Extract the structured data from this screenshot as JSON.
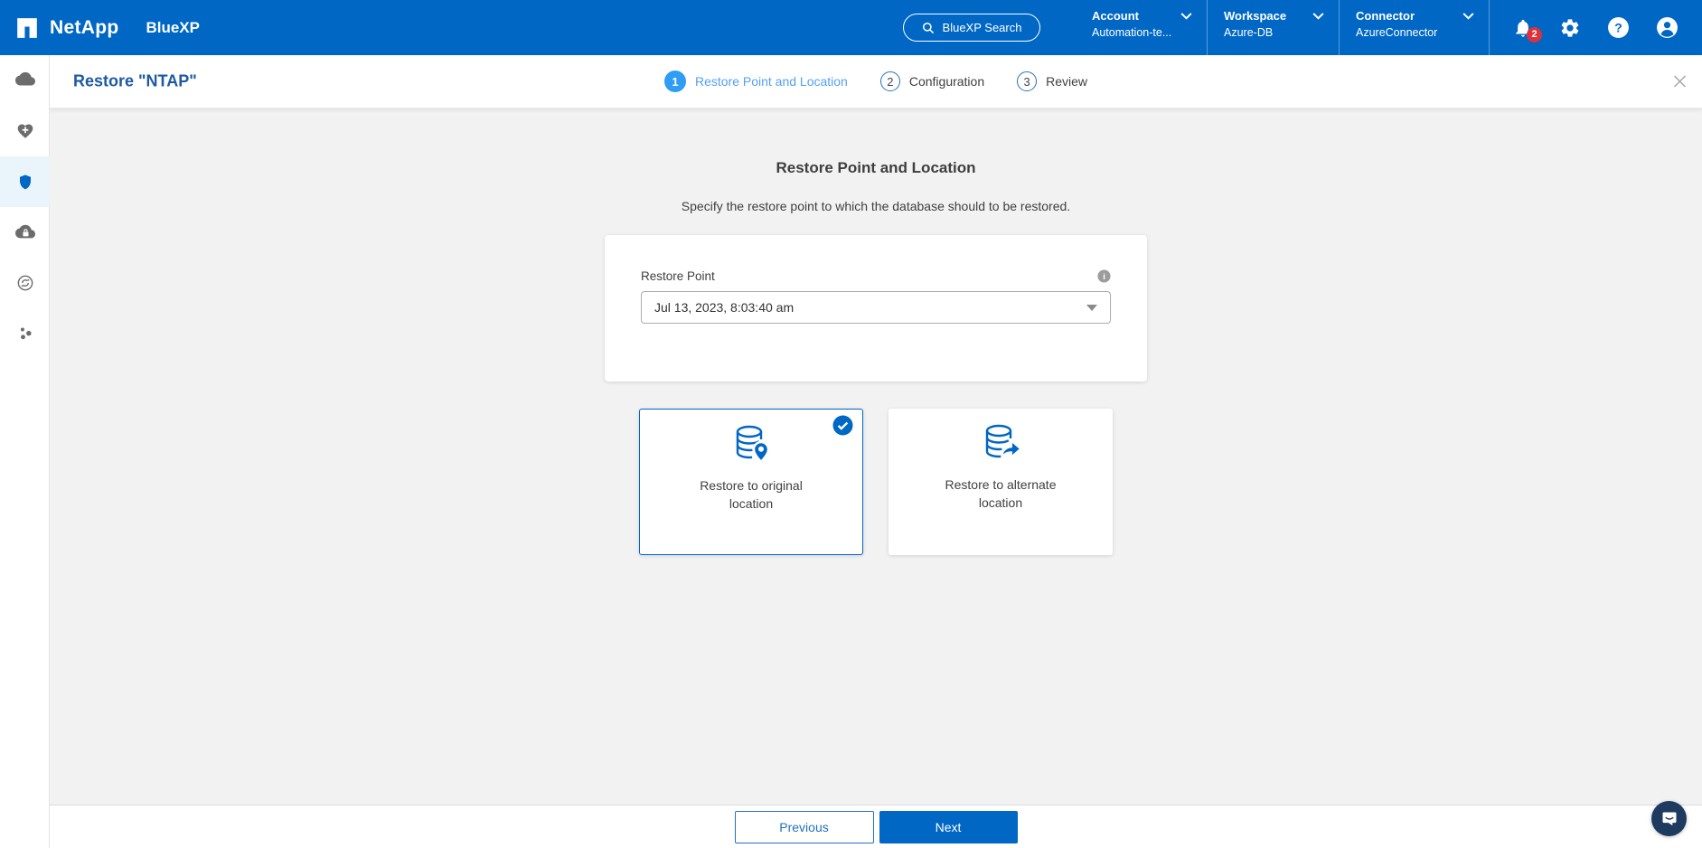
{
  "topbar": {
    "brand": {
      "company": "NetApp",
      "product": "BlueXP",
      "logo_icon": "netapp-logo"
    },
    "search": {
      "label": "BlueXP Search",
      "icon": "search-icon"
    },
    "account": {
      "label": "Account",
      "value": "Automation-te..."
    },
    "workspace": {
      "label": "Workspace",
      "value": "Azure-DB"
    },
    "connector": {
      "label": "Connector",
      "value": "AzureConnector"
    },
    "notifications": {
      "count": "2",
      "icon": "bell-icon"
    },
    "action_icons": [
      "bell-icon",
      "gear-icon",
      "help-icon",
      "account-icon"
    ]
  },
  "sidebar": {
    "items": [
      {
        "icon": "cloud-icon",
        "active": false
      },
      {
        "icon": "heart-plus-icon",
        "active": false
      },
      {
        "icon": "shield-icon",
        "active": true
      },
      {
        "icon": "cloud-lock-icon",
        "active": false
      },
      {
        "icon": "sync-circle-icon",
        "active": false
      },
      {
        "icon": "nodes-icon",
        "active": false
      }
    ]
  },
  "wizard": {
    "title": "Restore \"NTAP\"",
    "steps": [
      {
        "number": "1",
        "label": "Restore Point and Location",
        "state": "active"
      },
      {
        "number": "2",
        "label": "Configuration",
        "state": "upcoming"
      },
      {
        "number": "3",
        "label": "Review",
        "state": "upcoming"
      }
    ],
    "close_icon": "close-icon"
  },
  "main": {
    "heading": "Restore Point and Location",
    "subheading": "Specify the restore point to which the database should to be restored.",
    "restore_point": {
      "label": "Restore Point",
      "value": "Jul 13, 2023, 8:03:40 am",
      "info_icon": "info-icon",
      "caret_icon": "caret-down-icon"
    },
    "location_options": [
      {
        "label": "Restore to original location",
        "icon": "database-location-icon",
        "selected": true,
        "badge_icon": "check-badge-icon"
      },
      {
        "label": "Restore to alternate location",
        "icon": "database-share-icon",
        "selected": false
      }
    ]
  },
  "footer": {
    "previous_label": "Previous",
    "next_label": "Next",
    "chat_icon": "chat-bubble-icon"
  },
  "colors": {
    "header_bg": "#0067C5",
    "primary_blue": "#0067C5",
    "active_step_blue": "#2F9DF3",
    "title_blue": "#1E5AA2",
    "notification_red": "#DE3139",
    "content_bg": "#F2F2F2",
    "sidebar_active_bg": "#E9F4FB",
    "chat_bubble_navy": "#1E3A5F"
  }
}
